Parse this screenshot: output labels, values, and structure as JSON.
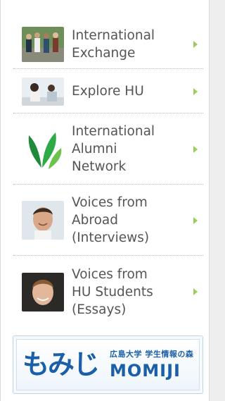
{
  "menu": {
    "items": [
      {
        "label": "International\nExchange"
      },
      {
        "label": "Explore HU"
      },
      {
        "label": "International\nAlumni\nNetwork"
      },
      {
        "label": "Voices from\nAbroad\n(Interviews)"
      },
      {
        "label": "Voices from\nHU Students\n(Essays)"
      }
    ]
  },
  "banner": {
    "kana": "もみじ",
    "sub": "広島大学 学生情報の森",
    "en": "MOMIJI"
  },
  "colors": {
    "text": "#555555",
    "arrow": "#9acd5a",
    "brand_blue": "#1a5fa8",
    "leaf_green": "#2e9a3a"
  }
}
